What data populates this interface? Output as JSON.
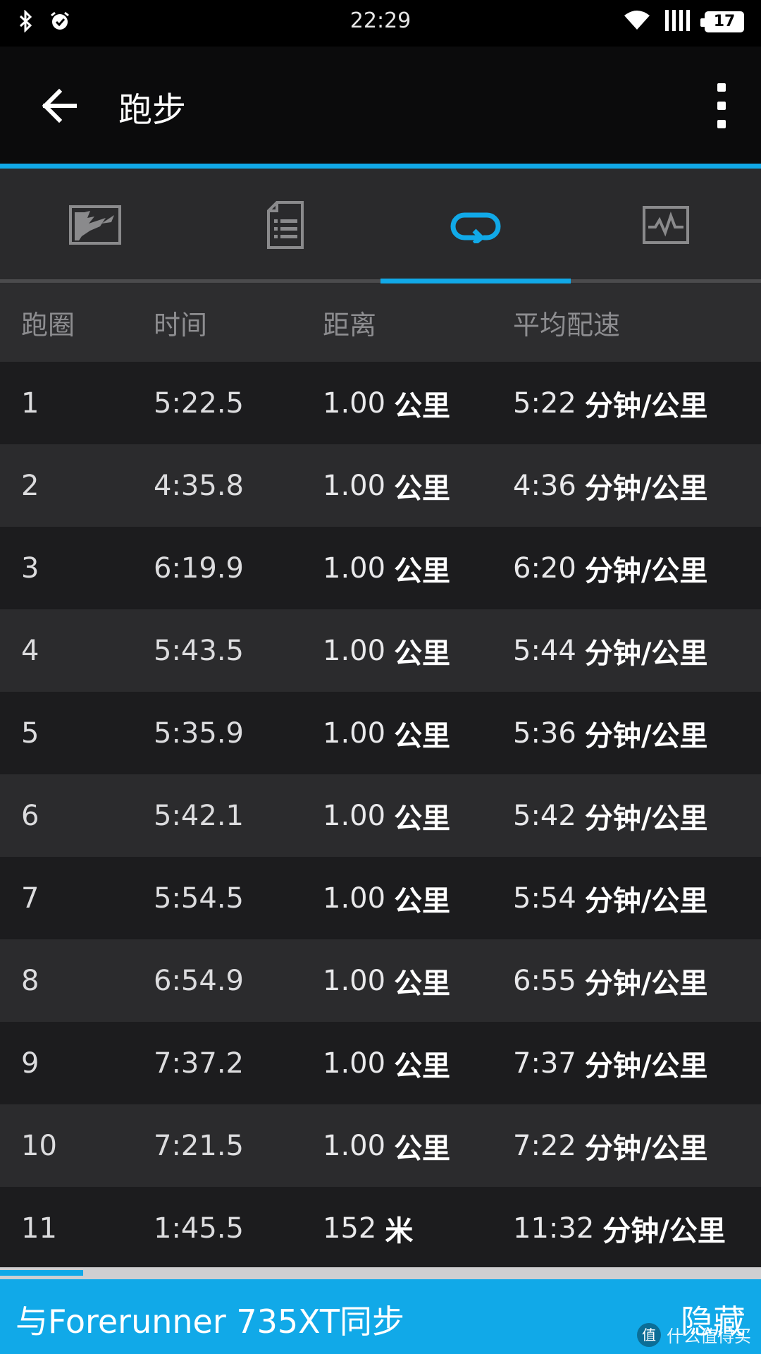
{
  "status_bar": {
    "time": "22:29",
    "battery": "17",
    "icons": [
      "bluetooth-icon",
      "alarm-icon",
      "wifi-icon",
      "signal-icon",
      "battery-icon"
    ]
  },
  "app_bar": {
    "title": "跑步"
  },
  "tabs": [
    {
      "icon": "map-icon",
      "active": false
    },
    {
      "icon": "details-list-icon",
      "active": false
    },
    {
      "icon": "laps-loop-icon",
      "active": true
    },
    {
      "icon": "chart-icon",
      "active": false
    }
  ],
  "table": {
    "headers": [
      "跑圈",
      "时间",
      "距离",
      "平均配速"
    ],
    "rows": [
      {
        "lap": "1",
        "time": "5:22.5",
        "distance": "1.00",
        "distance_unit": "公里",
        "pace": "5:22",
        "pace_unit": "分钟/公里"
      },
      {
        "lap": "2",
        "time": "4:35.8",
        "distance": "1.00",
        "distance_unit": "公里",
        "pace": "4:36",
        "pace_unit": "分钟/公里"
      },
      {
        "lap": "3",
        "time": "6:19.9",
        "distance": "1.00",
        "distance_unit": "公里",
        "pace": "6:20",
        "pace_unit": "分钟/公里"
      },
      {
        "lap": "4",
        "time": "5:43.5",
        "distance": "1.00",
        "distance_unit": "公里",
        "pace": "5:44",
        "pace_unit": "分钟/公里"
      },
      {
        "lap": "5",
        "time": "5:35.9",
        "distance": "1.00",
        "distance_unit": "公里",
        "pace": "5:36",
        "pace_unit": "分钟/公里"
      },
      {
        "lap": "6",
        "time": "5:42.1",
        "distance": "1.00",
        "distance_unit": "公里",
        "pace": "5:42",
        "pace_unit": "分钟/公里"
      },
      {
        "lap": "7",
        "time": "5:54.5",
        "distance": "1.00",
        "distance_unit": "公里",
        "pace": "5:54",
        "pace_unit": "分钟/公里"
      },
      {
        "lap": "8",
        "time": "6:54.9",
        "distance": "1.00",
        "distance_unit": "公里",
        "pace": "6:55",
        "pace_unit": "分钟/公里"
      },
      {
        "lap": "9",
        "time": "7:37.2",
        "distance": "1.00",
        "distance_unit": "公里",
        "pace": "7:37",
        "pace_unit": "分钟/公里"
      },
      {
        "lap": "10",
        "time": "7:21.5",
        "distance": "1.00",
        "distance_unit": "公里",
        "pace": "7:22",
        "pace_unit": "分钟/公里"
      },
      {
        "lap": "11",
        "time": "1:45.5",
        "distance": "152",
        "distance_unit": "米",
        "pace": "11:32",
        "pace_unit": "分钟/公里"
      }
    ]
  },
  "sync_banner": {
    "message": "与Forerunner 735XT同步",
    "hide_label": "隐藏"
  },
  "watermark": {
    "glyph": "值",
    "text": "什么值得买"
  },
  "colors": {
    "accent": "#11a9e8",
    "background": "#1d1d1f",
    "header_bg": "#2d2d2f"
  }
}
